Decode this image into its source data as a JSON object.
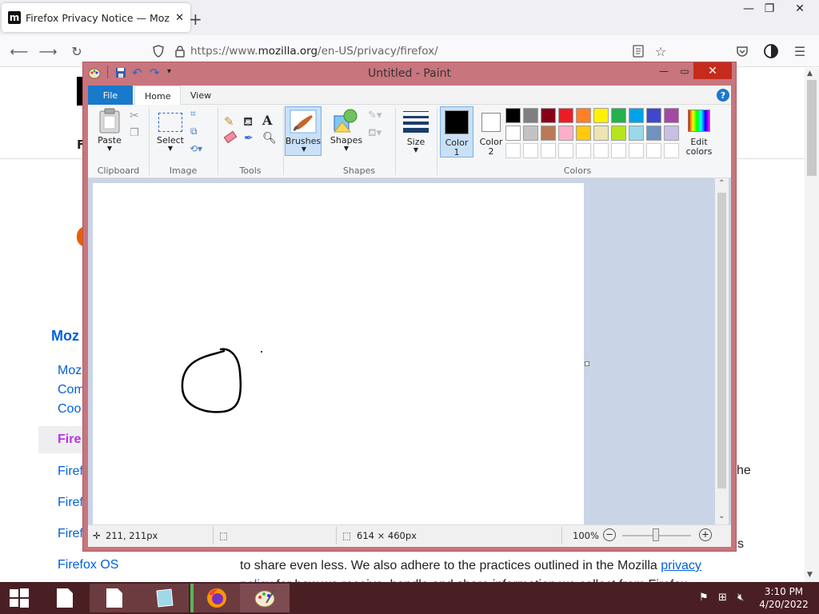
{
  "browser": {
    "tab_title": "Firefox Privacy Notice — Mozilla",
    "tab_favicon": "m",
    "new_tab_symbol": "+",
    "url_prefix": "https://www.",
    "url_domain": "mozilla.org",
    "url_path": "/en-US/privacy/firefox/"
  },
  "page": {
    "side_heading": "Moz",
    "side_links": [
      "Moz",
      "Com",
      "Coo",
      "Fire",
      "Firef",
      "Firef",
      "Firef",
      "Firefox OS"
    ],
    "side_active_index": 3,
    "right_fragment_1": "he",
    "right_fragment_2": "s",
    "body_line_1": "to share even less. We also adhere to the practices outlined in the Mozilla ",
    "body_link_1": "privacy",
    "body_line_2_link": "policy",
    "body_line_2": " for how we receive, handle and share information we collect from Firefox."
  },
  "paint": {
    "title": "Untitled - Paint",
    "tabs": {
      "file": "File",
      "home": "Home",
      "view": "View"
    },
    "help": "?",
    "groups": {
      "clipboard": "Clipboard",
      "image": "Image",
      "tools": "Tools",
      "shapes": "Shapes",
      "colors": "Colors"
    },
    "buttons": {
      "paste": "Paste",
      "select": "Select",
      "brushes": "Brushes",
      "shapes": "Shapes",
      "size": "Size",
      "color1_a": "Color",
      "color1_b": "1",
      "color2_a": "Color",
      "color2_b": "2",
      "edit_colors_a": "Edit",
      "edit_colors_b": "colors"
    },
    "palette_row1": [
      "#000000",
      "#7f7f7f",
      "#880015",
      "#ed1c24",
      "#ff7f27",
      "#fff200",
      "#22b14c",
      "#00a2e8",
      "#3f48cc",
      "#a349a4"
    ],
    "palette_row2": [
      "#ffffff",
      "#c3c3c3",
      "#b97a57",
      "#ffaec9",
      "#ffc90e",
      "#efe4b0",
      "#b5e61d",
      "#99d9ea",
      "#7092be",
      "#c8bfe7"
    ],
    "color1": "#000000",
    "color2": "#ffffff",
    "status": {
      "cursor": "211, 211px",
      "canvas_size": "614 × 460px",
      "zoom": "100%"
    }
  },
  "taskbar": {
    "time": "3:10 PM",
    "date": "4/20/2022"
  }
}
